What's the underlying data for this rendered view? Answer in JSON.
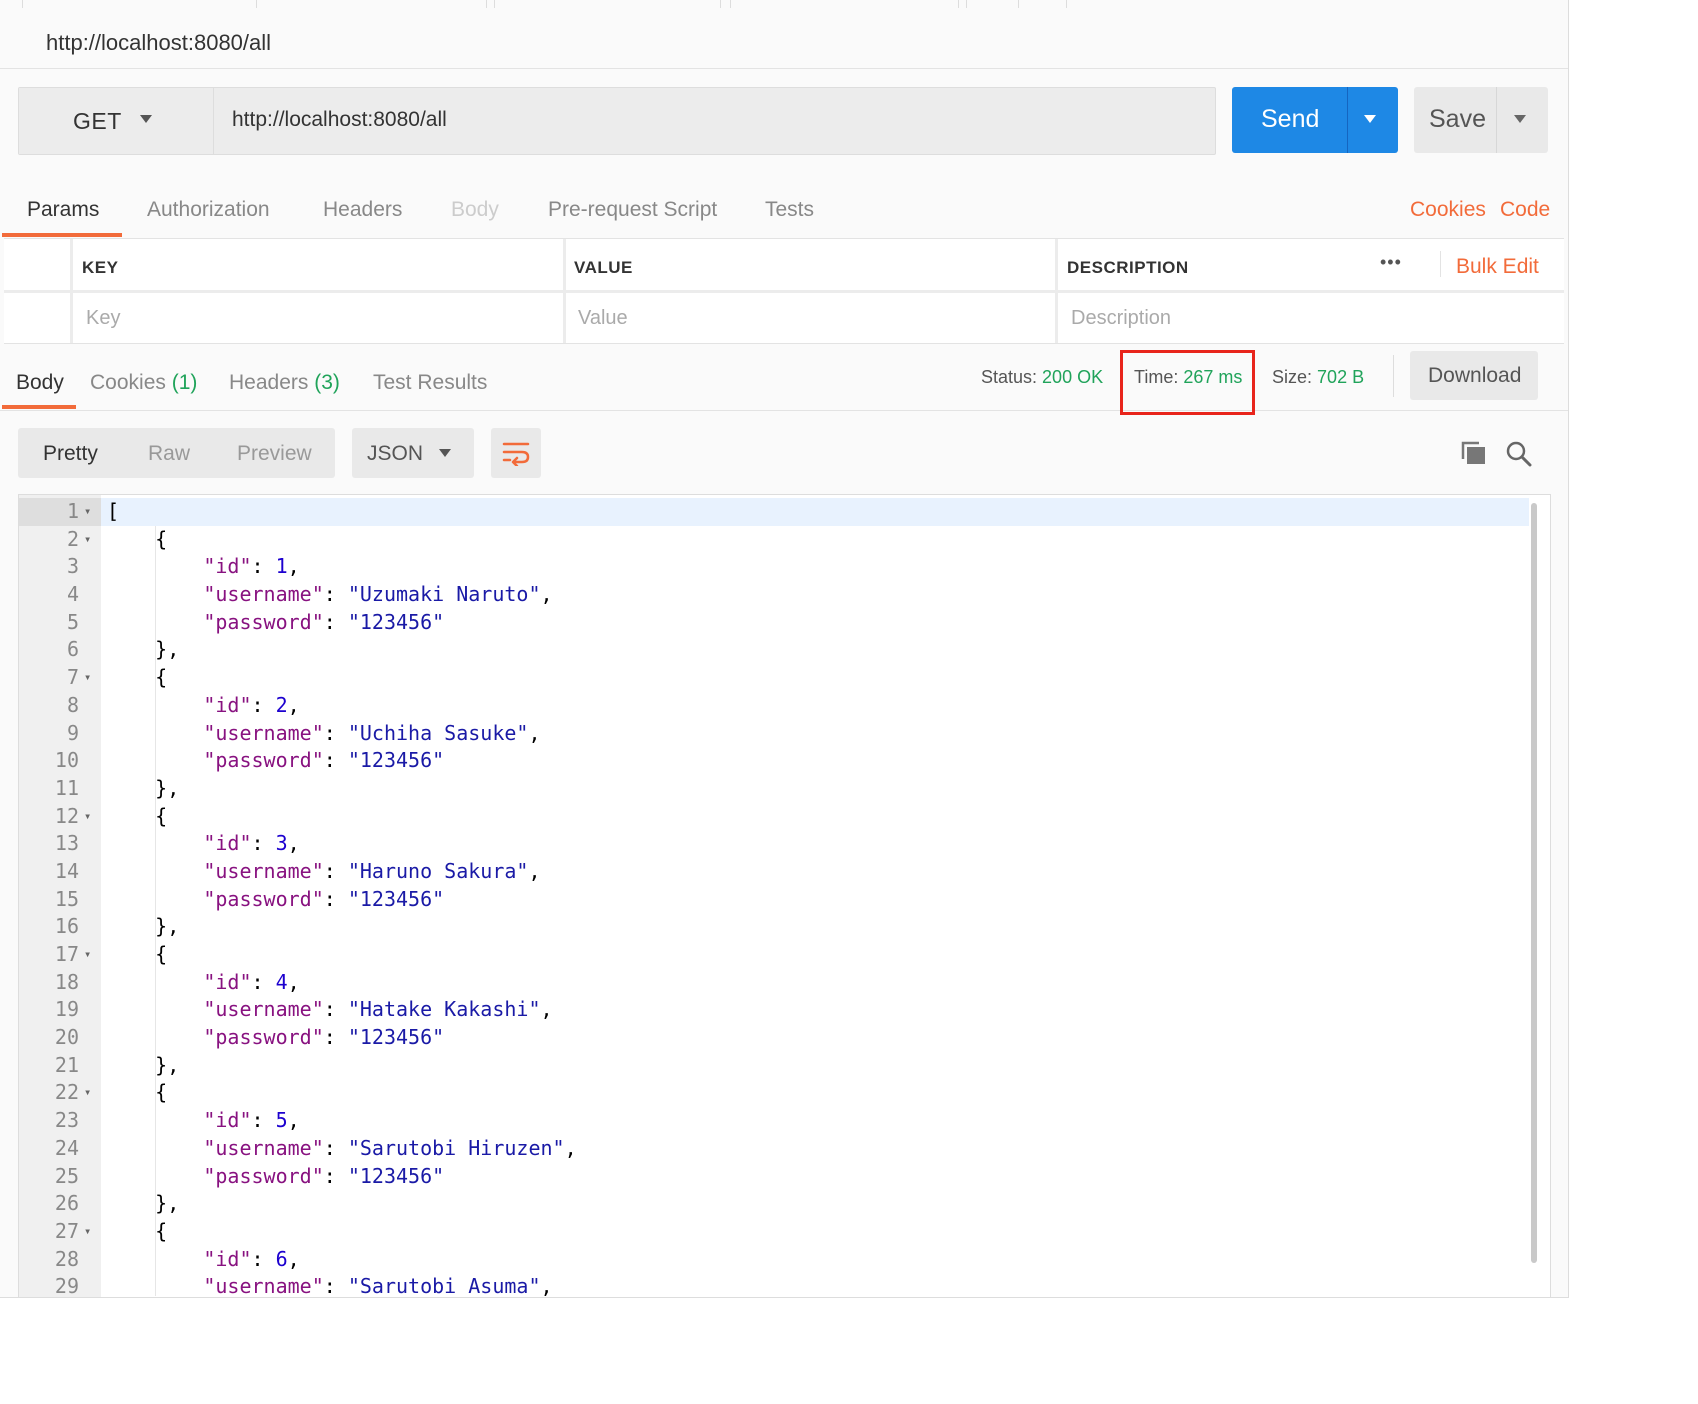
{
  "request_tab_title": "http://localhost:8080/all",
  "method": "GET",
  "url": "http://localhost:8080/all",
  "buttons": {
    "send": "Send",
    "save": "Save",
    "download": "Download"
  },
  "request_tabs": [
    {
      "label": "Params"
    },
    {
      "label": "Authorization"
    },
    {
      "label": "Headers"
    },
    {
      "label": "Body"
    },
    {
      "label": "Pre-request Script"
    },
    {
      "label": "Tests"
    }
  ],
  "request_links": {
    "cookies": "Cookies",
    "code": "Code"
  },
  "params_table": {
    "headers": {
      "key": "KEY",
      "value": "VALUE",
      "description": "DESCRIPTION"
    },
    "placeholders": {
      "key": "Key",
      "value": "Value",
      "description": "Description"
    },
    "more": "•••",
    "bulk_edit": "Bulk Edit"
  },
  "response_tabs": [
    {
      "label": "Body",
      "count": ""
    },
    {
      "label": "Cookies",
      "count": "(1)"
    },
    {
      "label": "Headers",
      "count": "(3)"
    },
    {
      "label": "Test Results",
      "count": ""
    }
  ],
  "status": {
    "status_label": "Status:",
    "status_value": "200 OK",
    "time_label": "Time:",
    "time_value": "267 ms",
    "size_label": "Size:",
    "size_value": "702 B"
  },
  "view_modes": [
    "Pretty",
    "Raw",
    "Preview"
  ],
  "format": "JSON",
  "colors": {
    "accent": "#f26b3a",
    "send": "#1e88e5",
    "ok": "#20a35a",
    "highlight_box": "#e8241b"
  },
  "icons": [
    "caret-down-icon",
    "wrap-lines-icon",
    "copy-icon",
    "search-icon"
  ],
  "response_lines": [
    {
      "n": "1",
      "fold": true,
      "code": [
        [
          "p",
          "["
        ]
      ]
    },
    {
      "n": "2",
      "fold": true,
      "code": [
        [
          "p",
          "    {"
        ]
      ]
    },
    {
      "n": "3",
      "code": [
        [
          "p",
          "        "
        ],
        [
          "k",
          "\"id\""
        ],
        [
          "p",
          ": "
        ],
        [
          "n",
          "1"
        ],
        [
          "p",
          ","
        ]
      ]
    },
    {
      "n": "4",
      "code": [
        [
          "p",
          "        "
        ],
        [
          "k",
          "\"username\""
        ],
        [
          "p",
          ": "
        ],
        [
          "s",
          "\"Uzumaki Naruto\""
        ],
        [
          "p",
          ","
        ]
      ]
    },
    {
      "n": "5",
      "code": [
        [
          "p",
          "        "
        ],
        [
          "k",
          "\"password\""
        ],
        [
          "p",
          ": "
        ],
        [
          "s",
          "\"123456\""
        ]
      ]
    },
    {
      "n": "6",
      "code": [
        [
          "p",
          "    },"
        ]
      ]
    },
    {
      "n": "7",
      "fold": true,
      "code": [
        [
          "p",
          "    {"
        ]
      ]
    },
    {
      "n": "8",
      "code": [
        [
          "p",
          "        "
        ],
        [
          "k",
          "\"id\""
        ],
        [
          "p",
          ": "
        ],
        [
          "n",
          "2"
        ],
        [
          "p",
          ","
        ]
      ]
    },
    {
      "n": "9",
      "code": [
        [
          "p",
          "        "
        ],
        [
          "k",
          "\"username\""
        ],
        [
          "p",
          ": "
        ],
        [
          "s",
          "\"Uchiha Sasuke\""
        ],
        [
          "p",
          ","
        ]
      ]
    },
    {
      "n": "10",
      "code": [
        [
          "p",
          "        "
        ],
        [
          "k",
          "\"password\""
        ],
        [
          "p",
          ": "
        ],
        [
          "s",
          "\"123456\""
        ]
      ]
    },
    {
      "n": "11",
      "code": [
        [
          "p",
          "    },"
        ]
      ]
    },
    {
      "n": "12",
      "fold": true,
      "code": [
        [
          "p",
          "    {"
        ]
      ]
    },
    {
      "n": "13",
      "code": [
        [
          "p",
          "        "
        ],
        [
          "k",
          "\"id\""
        ],
        [
          "p",
          ": "
        ],
        [
          "n",
          "3"
        ],
        [
          "p",
          ","
        ]
      ]
    },
    {
      "n": "14",
      "code": [
        [
          "p",
          "        "
        ],
        [
          "k",
          "\"username\""
        ],
        [
          "p",
          ": "
        ],
        [
          "s",
          "\"Haruno Sakura\""
        ],
        [
          "p",
          ","
        ]
      ]
    },
    {
      "n": "15",
      "code": [
        [
          "p",
          "        "
        ],
        [
          "k",
          "\"password\""
        ],
        [
          "p",
          ": "
        ],
        [
          "s",
          "\"123456\""
        ]
      ]
    },
    {
      "n": "16",
      "code": [
        [
          "p",
          "    },"
        ]
      ]
    },
    {
      "n": "17",
      "fold": true,
      "code": [
        [
          "p",
          "    {"
        ]
      ]
    },
    {
      "n": "18",
      "code": [
        [
          "p",
          "        "
        ],
        [
          "k",
          "\"id\""
        ],
        [
          "p",
          ": "
        ],
        [
          "n",
          "4"
        ],
        [
          "p",
          ","
        ]
      ]
    },
    {
      "n": "19",
      "code": [
        [
          "p",
          "        "
        ],
        [
          "k",
          "\"username\""
        ],
        [
          "p",
          ": "
        ],
        [
          "s",
          "\"Hatake Kakashi\""
        ],
        [
          "p",
          ","
        ]
      ]
    },
    {
      "n": "20",
      "code": [
        [
          "p",
          "        "
        ],
        [
          "k",
          "\"password\""
        ],
        [
          "p",
          ": "
        ],
        [
          "s",
          "\"123456\""
        ]
      ]
    },
    {
      "n": "21",
      "code": [
        [
          "p",
          "    },"
        ]
      ]
    },
    {
      "n": "22",
      "fold": true,
      "code": [
        [
          "p",
          "    {"
        ]
      ]
    },
    {
      "n": "23",
      "code": [
        [
          "p",
          "        "
        ],
        [
          "k",
          "\"id\""
        ],
        [
          "p",
          ": "
        ],
        [
          "n",
          "5"
        ],
        [
          "p",
          ","
        ]
      ]
    },
    {
      "n": "24",
      "code": [
        [
          "p",
          "        "
        ],
        [
          "k",
          "\"username\""
        ],
        [
          "p",
          ": "
        ],
        [
          "s",
          "\"Sarutobi Hiruzen\""
        ],
        [
          "p",
          ","
        ]
      ]
    },
    {
      "n": "25",
      "code": [
        [
          "p",
          "        "
        ],
        [
          "k",
          "\"password\""
        ],
        [
          "p",
          ": "
        ],
        [
          "s",
          "\"123456\""
        ]
      ]
    },
    {
      "n": "26",
      "code": [
        [
          "p",
          "    },"
        ]
      ]
    },
    {
      "n": "27",
      "fold": true,
      "code": [
        [
          "p",
          "    {"
        ]
      ]
    },
    {
      "n": "28",
      "code": [
        [
          "p",
          "        "
        ],
        [
          "k",
          "\"id\""
        ],
        [
          "p",
          ": "
        ],
        [
          "n",
          "6"
        ],
        [
          "p",
          ","
        ]
      ]
    },
    {
      "n": "29",
      "code": [
        [
          "p",
          "        "
        ],
        [
          "k",
          "\"username\""
        ],
        [
          "p",
          ": "
        ],
        [
          "s",
          "\"Sarutobi Asuma\""
        ],
        [
          "p",
          ","
        ]
      ]
    }
  ]
}
